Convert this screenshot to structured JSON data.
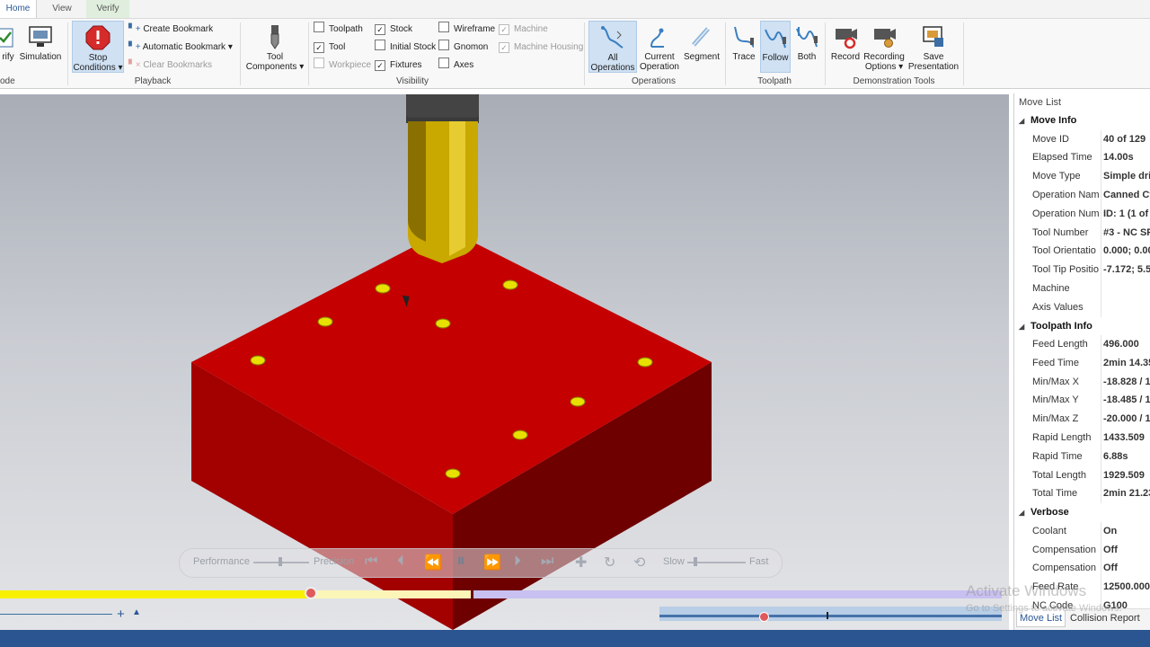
{
  "tabs": [
    "Home",
    "View",
    "Verify"
  ],
  "ribbon": {
    "verify_label": "rify",
    "simulation_label": "Simulation",
    "mode_label": "ode",
    "stop_conditions_line1": "Stop",
    "stop_conditions_line2": "Conditions",
    "create_bookmark": "Create Bookmark",
    "automatic_bookmark": "Automatic Bookmark",
    "clear_bookmarks": "Clear Bookmarks",
    "playback_label": "Playback",
    "tool_components_line1": "Tool",
    "tool_components_line2": "Components",
    "visibility": {
      "toolpath": "Toolpath",
      "tool": "Tool",
      "workpiece": "Workpiece",
      "stock": "Stock",
      "initial_stock": "Initial Stock",
      "fixtures": "Fixtures",
      "wireframe": "Wireframe",
      "gnomon": "Gnomon",
      "axes": "Axes",
      "machine": "Machine",
      "machine_housing": "Machine Housing",
      "label": "Visibility"
    },
    "operations": {
      "all_line1": "All",
      "all_line2": "Operations",
      "current_line1": "Current",
      "current_line2": "Operation",
      "segment": "Segment",
      "label": "Operations"
    },
    "toolpath": {
      "trace": "Trace",
      "follow": "Follow",
      "both": "Both",
      "label": "Toolpath"
    },
    "demo": {
      "record": "Record",
      "recording_line1": "Recording",
      "recording_line2": "Options",
      "save_line1": "Save",
      "save_line2": "Presentation",
      "label": "Demonstration Tools"
    }
  },
  "playbar": {
    "performance": "Performance",
    "precision": "Precision",
    "slow": "Slow",
    "fast": "Fast"
  },
  "progress": {
    "fraction": 0.31
  },
  "panel": {
    "title": "Move List",
    "sections": [
      {
        "name": "Move Info",
        "rows": [
          [
            "Move ID",
            "40 of 129"
          ],
          [
            "Elapsed Time",
            "14.00s"
          ],
          [
            "Move Type",
            "Simple dri"
          ],
          [
            "Operation Nam",
            "Canned Cy"
          ],
          [
            "Operation Num",
            "ID: 1 (1 of"
          ],
          [
            "Tool Number",
            "#3 - NC SP"
          ],
          [
            "Tool Orientatio",
            "0.000; 0.00"
          ],
          [
            "Tool Tip Positio",
            "-7.172; 5.5"
          ],
          [
            "Machine",
            ""
          ],
          [
            "Axis Values",
            ""
          ]
        ]
      },
      {
        "name": "Toolpath Info",
        "rows": [
          [
            "Feed Length",
            "496.000"
          ],
          [
            "Feed Time",
            "2min 14.35"
          ],
          [
            "Min/Max X",
            "-18.828 / 1"
          ],
          [
            "Min/Max Y",
            "-18.485 / 1"
          ],
          [
            "Min/Max Z",
            "-20.000 / 1"
          ],
          [
            "Rapid Length",
            "1433.509"
          ],
          [
            "Rapid Time",
            "6.88s"
          ],
          [
            "Total Length",
            "1929.509"
          ],
          [
            "Total Time",
            "2min 21.23"
          ]
        ]
      },
      {
        "name": "Verbose",
        "rows": [
          [
            "Coolant",
            "On"
          ],
          [
            "Compensation",
            "Off"
          ],
          [
            "Compensation",
            "Off"
          ],
          [
            "Feed Rate",
            "12500.000"
          ],
          [
            "NC Code",
            "G100"
          ]
        ]
      }
    ],
    "tabs": [
      "Move List",
      "Collision Report"
    ]
  },
  "watermark": {
    "line1": "Activate Windows",
    "line2": "Go to Settings to activate Windows."
  },
  "colors": {
    "stock_top": "#c40000",
    "stock_left": "#a30000",
    "stock_right": "#6e0000",
    "hole": "#e8e000",
    "status": "#2a5590"
  }
}
